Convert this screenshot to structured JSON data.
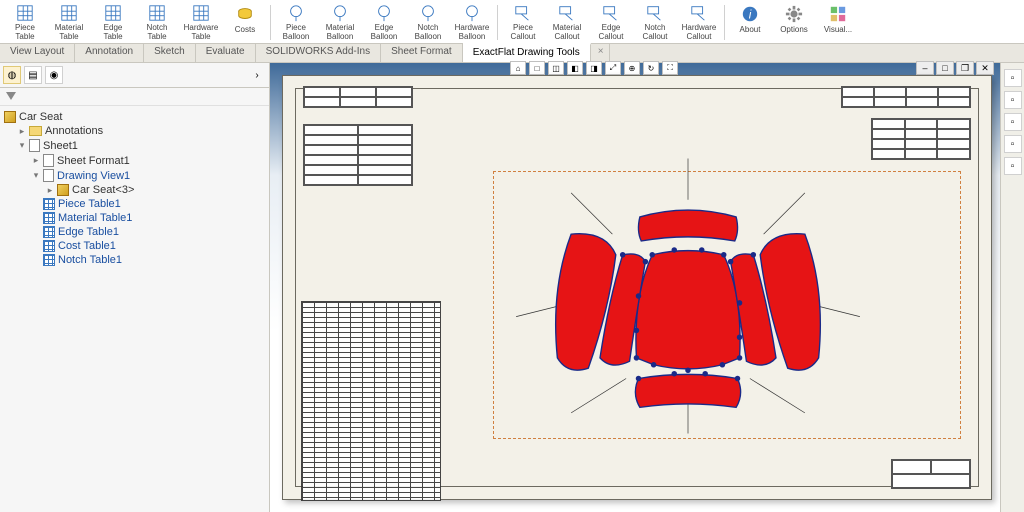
{
  "ribbon": [
    {
      "id": "piece-table",
      "label": "Piece\nTable",
      "icon": "grid"
    },
    {
      "id": "material-table",
      "label": "Material\nTable",
      "icon": "grid"
    },
    {
      "id": "edge-table",
      "label": "Edge\nTable",
      "icon": "grid"
    },
    {
      "id": "notch-table",
      "label": "Notch\nTable",
      "icon": "grid"
    },
    {
      "id": "hardware-table",
      "label": "Hardware\nTable",
      "icon": "grid"
    },
    {
      "id": "costs",
      "label": "Costs",
      "icon": "coin"
    },
    {
      "sep": true
    },
    {
      "id": "piece-balloon",
      "label": "Piece\nBalloon",
      "icon": "balloon"
    },
    {
      "id": "material-balloon",
      "label": "Material\nBalloon",
      "icon": "balloon"
    },
    {
      "id": "edge-balloon",
      "label": "Edge\nBalloon",
      "icon": "balloon"
    },
    {
      "id": "notch-balloon",
      "label": "Notch\nBalloon",
      "icon": "balloon"
    },
    {
      "id": "hardware-balloon",
      "label": "Hardware\nBalloon",
      "icon": "balloon"
    },
    {
      "sep": true
    },
    {
      "id": "piece-callout",
      "label": "Piece\nCallout",
      "icon": "callout"
    },
    {
      "id": "material-callout",
      "label": "Material\nCallout",
      "icon": "callout"
    },
    {
      "id": "edge-callout",
      "label": "Edge\nCallout",
      "icon": "callout"
    },
    {
      "id": "notch-callout",
      "label": "Notch\nCallout",
      "icon": "callout"
    },
    {
      "id": "hardware-callout",
      "label": "Hardware\nCallout",
      "icon": "callout"
    },
    {
      "sep": true
    },
    {
      "id": "about",
      "label": "About",
      "icon": "info"
    },
    {
      "id": "options",
      "label": "Options",
      "icon": "gear"
    },
    {
      "id": "visual",
      "label": "Visual...",
      "icon": "boxes"
    }
  ],
  "tabs": [
    {
      "label": "View Layout"
    },
    {
      "label": "Annotation"
    },
    {
      "label": "Sketch"
    },
    {
      "label": "Evaluate"
    },
    {
      "label": "SOLIDWORKS Add-Ins"
    },
    {
      "label": "Sheet Format"
    },
    {
      "label": "ExactFlat Drawing Tools",
      "active": true
    }
  ],
  "tree": {
    "root": "Car Seat",
    "children": [
      {
        "icon": "folder",
        "label": "Annotations",
        "tw": "▸"
      },
      {
        "icon": "sheet",
        "label": "Sheet1",
        "tw": "▾",
        "children": [
          {
            "icon": "sheet",
            "label": "Sheet Format1",
            "tw": "▸"
          },
          {
            "icon": "sheet",
            "label": "Drawing View1",
            "tw": "▾",
            "link": true,
            "children": [
              {
                "icon": "cube",
                "label": "Car Seat<3>",
                "tw": "▸"
              }
            ]
          },
          {
            "icon": "grid",
            "label": "Piece Table1",
            "link": true
          },
          {
            "icon": "grid",
            "label": "Material Table1",
            "link": true
          },
          {
            "icon": "grid",
            "label": "Edge Table1",
            "link": true
          },
          {
            "icon": "grid",
            "label": "Cost Table1",
            "link": true
          },
          {
            "icon": "grid",
            "label": "Notch Table1",
            "link": true
          }
        ]
      }
    ]
  },
  "right_rail": [
    "home-icon",
    "layers-icon",
    "view-icon",
    "colors-icon",
    "more-icon"
  ],
  "view_strip": [
    "⌂",
    "□",
    "◫",
    "◧",
    "◨",
    "⤢",
    "⊕",
    "↻",
    "⛶"
  ],
  "win_ctrl": [
    "–",
    "□",
    "❐",
    "✕"
  ],
  "colors": {
    "piece": "#e61415",
    "stroke": "#1a2a88"
  }
}
